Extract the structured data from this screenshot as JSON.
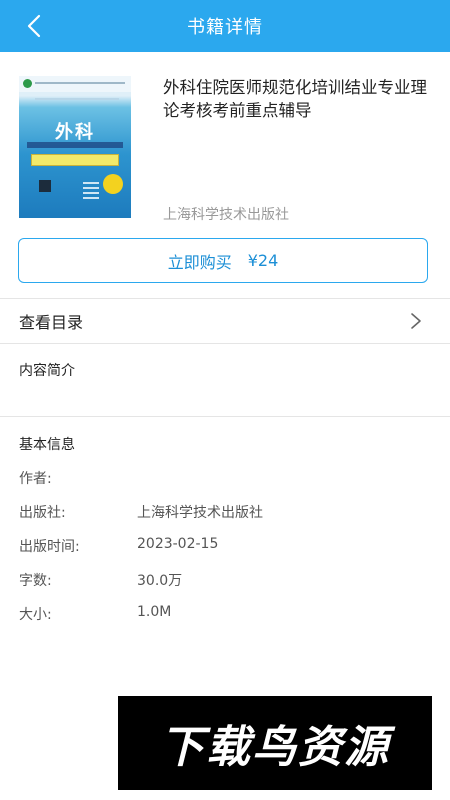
{
  "header": {
    "title": "书籍详情",
    "back_icon": "chevron-left-icon"
  },
  "book": {
    "cover_title": "外科",
    "title": "外科住院医师规范化培训结业专业理论考核考前重点辅导",
    "publisher": "上海科学技术出版社"
  },
  "buy": {
    "label": "立即购买",
    "price": "¥24"
  },
  "catalog": {
    "label": "查看目录",
    "icon": "chevron-right-icon"
  },
  "intro": {
    "label": "内容简介"
  },
  "basic_info": {
    "title": "基本信息",
    "rows": [
      {
        "key": "作者:",
        "value": ""
      },
      {
        "key": "出版社:",
        "value": "上海科学技术出版社"
      },
      {
        "key": "出版时间:",
        "value": "2023-02-15"
      },
      {
        "key": "字数:",
        "value": "30.0万"
      },
      {
        "key": "大小:",
        "value": "1.0M"
      }
    ]
  },
  "watermark": {
    "text": "下载鸟资源"
  },
  "colors": {
    "accent": "#2ba8ee",
    "link_text": "#1c8fd6"
  }
}
